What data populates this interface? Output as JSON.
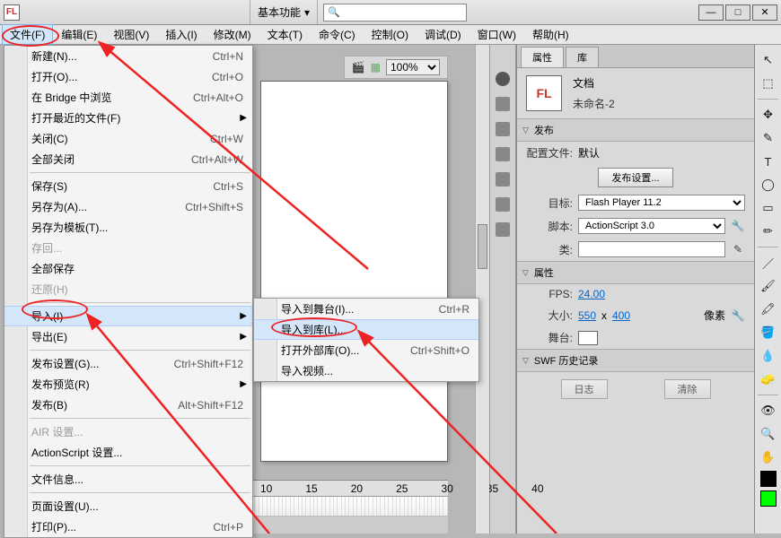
{
  "app": {
    "logo": "FL"
  },
  "titlebar": {
    "layout_label": "基本功能"
  },
  "menubar": {
    "items": [
      "文件(F)",
      "编辑(E)",
      "视图(V)",
      "插入(I)",
      "修改(M)",
      "文本(T)",
      "命令(C)",
      "控制(O)",
      "调试(D)",
      "窗口(W)",
      "帮助(H)"
    ]
  },
  "file_menu": {
    "items": [
      {
        "label": "新建(N)...",
        "sc": "Ctrl+N"
      },
      {
        "label": "打开(O)...",
        "sc": "Ctrl+O"
      },
      {
        "label": "在 Bridge 中浏览",
        "sc": "Ctrl+Alt+O"
      },
      {
        "label": "打开最近的文件(F)",
        "arrow": true
      },
      {
        "label": "关闭(C)",
        "sc": "Ctrl+W"
      },
      {
        "label": "全部关闭",
        "sc": "Ctrl+Alt+W"
      },
      {
        "sep": true
      },
      {
        "label": "保存(S)",
        "sc": "Ctrl+S"
      },
      {
        "label": "另存为(A)...",
        "sc": "Ctrl+Shift+S"
      },
      {
        "label": "另存为模板(T)..."
      },
      {
        "label": "存回...",
        "disabled": true
      },
      {
        "label": "全部保存"
      },
      {
        "label": "还原(H)",
        "disabled": true
      },
      {
        "sep": true
      },
      {
        "label": "导入(I)",
        "arrow": true,
        "highlight": true
      },
      {
        "label": "导出(E)",
        "arrow": true
      },
      {
        "sep": true
      },
      {
        "label": "发布设置(G)...",
        "sc": "Ctrl+Shift+F12"
      },
      {
        "label": "发布预览(R)",
        "arrow": true
      },
      {
        "label": "发布(B)",
        "sc": "Alt+Shift+F12"
      },
      {
        "sep": true
      },
      {
        "label": "AIR 设置...",
        "disabled": true
      },
      {
        "label": "ActionScript 设置..."
      },
      {
        "sep": true
      },
      {
        "label": "文件信息..."
      },
      {
        "sep": true
      },
      {
        "label": "页面设置(U)..."
      },
      {
        "label": "打印(P)...",
        "sc": "Ctrl+P"
      }
    ]
  },
  "import_submenu": {
    "items": [
      {
        "label": "导入到舞台(I)...",
        "sc": "Ctrl+R"
      },
      {
        "label": "导入到库(L)...",
        "highlight": true
      },
      {
        "label": "打开外部库(O)...",
        "sc": "Ctrl+Shift+O"
      },
      {
        "label": "导入视频..."
      }
    ]
  },
  "doc_toolbar": {
    "zoom": "100%"
  },
  "timeline": {
    "marks": [
      "10",
      "15",
      "20",
      "25",
      "30",
      "35",
      "40"
    ]
  },
  "properties": {
    "tabs": [
      "属性",
      "库"
    ],
    "doc_type": "文档",
    "doc_name": "未命名-2",
    "publish": {
      "header": "发布",
      "profile_label": "配置文件:",
      "profile_value": "默认",
      "settings_btn": "发布设置...",
      "target_label": "目标:",
      "target_value": "Flash Player 11.2",
      "script_label": "脚本:",
      "script_value": "ActionScript 3.0",
      "class_label": "类:"
    },
    "props": {
      "header": "属性",
      "fps_label": "FPS:",
      "fps_value": "24.00",
      "size_label": "大小:",
      "width": "550",
      "height": "400",
      "x_sep": "x",
      "unit": "像素",
      "stage_label": "舞台:"
    },
    "swf": {
      "header": "SWF 历史记录",
      "log_btn": "日志",
      "clear_btn": "清除"
    }
  },
  "tools": [
    "↖",
    "⬚",
    "✥",
    "✎",
    "T",
    "◯",
    "▭",
    "✏",
    "／",
    "🖌",
    "🖍",
    "🪣",
    "💧",
    "🧽",
    "👁",
    "🔍",
    "✋"
  ]
}
